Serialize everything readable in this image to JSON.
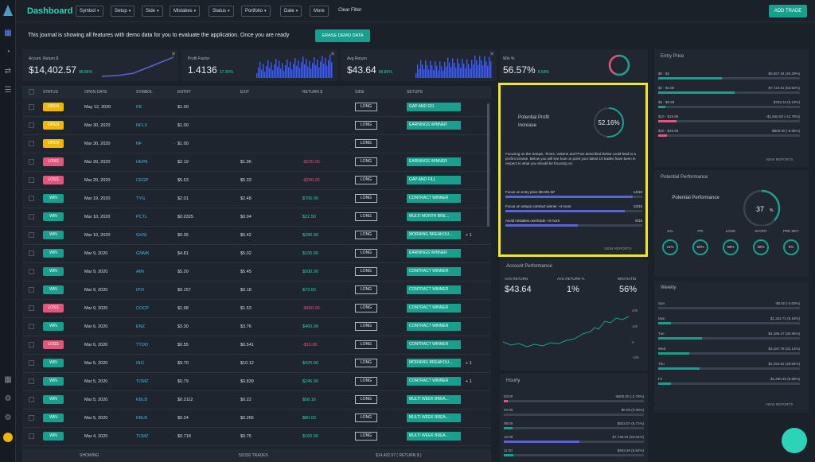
{
  "header": {
    "title": "Dashboard",
    "clear_filter": "Clear Filter",
    "add_trade": "ADD TRADE",
    "filters": [
      "Symbol",
      "Setup",
      "Side",
      "Mistakes",
      "Status",
      "Portfolio",
      "Date",
      "More"
    ]
  },
  "notice": {
    "text": "This journal is showing all features with demo data for you to evaluate the application. Once you are ready",
    "erase": "ERASE DEMO DATA"
  },
  "kpis": [
    {
      "label": "Accum. Return $",
      "value": "$14,402.57",
      "change": "98.86%"
    },
    {
      "label": "Profit Factor",
      "value": "1.4136",
      "change": "17.26%"
    },
    {
      "label": "Avg Return",
      "value": "$43.64",
      "change": "99.86%"
    },
    {
      "label": "Win %",
      "value": "56.57%",
      "change": "8.59%"
    }
  ],
  "table": {
    "headers": [
      "STATUS",
      "OPEN DATE",
      "SYMBOL",
      "ENTRY",
      "EXIT",
      "RETURN $",
      "SIDE",
      "SETUPS"
    ],
    "rows": [
      {
        "status": "OPEN",
        "date": "May 12, 2020",
        "symbol": "FB",
        "entry": "$1.00",
        "exit": "",
        "ret": "",
        "side": "LONG",
        "setup": "GAP AND GO",
        "plus": ""
      },
      {
        "status": "OPEN",
        "date": "Mar 30, 2020",
        "symbol": "NFLX",
        "entry": "$1.00",
        "exit": "",
        "ret": "",
        "side": "LONG",
        "setup": "EARNINGS WINNER",
        "plus": ""
      },
      {
        "status": "OPEN",
        "date": "Mar 30, 2020",
        "symbol": "NF",
        "entry": "$1.00",
        "exit": "",
        "ret": "",
        "side": "LONG",
        "setup": "",
        "plus": ""
      },
      {
        "status": "LOSS",
        "date": "Mar 20, 2020",
        "symbol": "HEPA",
        "entry": "$2.19",
        "exit": "$1.96",
        "ret": "-$230.00",
        "side": "LONG",
        "setup": "EARNINGS WINNER",
        "plus": ""
      },
      {
        "status": "LOSS",
        "date": "Mar 20, 2020",
        "symbol": "CEGP",
        "entry": "$5.53",
        "exit": "$5.33",
        "ret": "-$200.00",
        "side": "LONG",
        "setup": "GAP AND FILL",
        "plus": ""
      },
      {
        "status": "WIN",
        "date": "Mar 19, 2020",
        "symbol": "TYG",
        "entry": "$2.01",
        "exit": "$2.48",
        "ret": "$705.00",
        "side": "LONG",
        "setup": "CONTRACT WINNER",
        "plus": ""
      },
      {
        "status": "WIN",
        "date": "Mar 10, 2020",
        "symbol": "PCTL",
        "entry": "$0.0325",
        "exit": "$0.04",
        "ret": "$22.50",
        "side": "LONG",
        "setup": "MULTI MONTH BRE...",
        "plus": ""
      },
      {
        "status": "WIN",
        "date": "Mar 10, 2020",
        "symbol": "GHSI",
        "entry": "$0.36",
        "exit": "$0.42",
        "ret": "$280.00",
        "side": "LONG",
        "setup": "MORNING BREAKOU...",
        "plus": "+ 1"
      },
      {
        "status": "WIN",
        "date": "Mar 9, 2020",
        "symbol": "GNMK",
        "entry": "$4.81",
        "exit": "$5.02",
        "ret": "$105.00",
        "side": "LONG",
        "setup": "EARNINGS WINNER",
        "plus": ""
      },
      {
        "status": "WIN",
        "date": "Mar 9, 2020",
        "symbol": "AIM",
        "entry": "$5.20",
        "exit": "$5.45",
        "ret": "$500.00",
        "side": "LONG",
        "setup": "CONTRACT WINNER",
        "plus": ""
      },
      {
        "status": "WIN",
        "date": "Mar 9, 2020",
        "symbol": "IPIX",
        "entry": "$0.157",
        "exit": "$0.18",
        "ret": "$73.60",
        "side": "LONG",
        "setup": "CONTRACT WINNER",
        "plus": ""
      },
      {
        "status": "LOSS",
        "date": "Mar 9, 2020",
        "symbol": "COCP",
        "entry": "$1.98",
        "exit": "$1.53",
        "ret": "-$450.00",
        "side": "LONG",
        "setup": "CONTRACT WINNER",
        "plus": ""
      },
      {
        "status": "WIN",
        "date": "Mar 6, 2020",
        "symbol": "ENZ",
        "entry": "$3.30",
        "exit": "$3.76",
        "ret": "$460.00",
        "side": "LONG",
        "setup": "CONTRACT WINNER",
        "plus": ""
      },
      {
        "status": "LOSS",
        "date": "Mar 6, 2020",
        "symbol": "TTOO",
        "entry": "$0.55",
        "exit": "$0.541",
        "ret": "-$10.80",
        "side": "LONG",
        "setup": "CONTRACT WINNER",
        "plus": ""
      },
      {
        "status": "WIN",
        "date": "Mar 5, 2020",
        "symbol": "INO",
        "entry": "$9.70",
        "exit": "$10.12",
        "ret": "$420.00",
        "side": "LONG",
        "setup": "MORNING BREAKOU...",
        "plus": "+ 1"
      },
      {
        "status": "WIN",
        "date": "Mar 5, 2020",
        "symbol": "TOMZ",
        "entry": "$0.79",
        "exit": "$0.839",
        "ret": "$245.00",
        "side": "LONG",
        "setup": "CONTRACT WINNER",
        "plus": "+ 1"
      },
      {
        "status": "WIN",
        "date": "Mar 5, 2020",
        "symbol": "KBLB",
        "entry": "$0.2112",
        "exit": "$0.22",
        "ret": "$58.16",
        "side": "LONG",
        "setup": "MULTI WEEK BREA...",
        "plus": ""
      },
      {
        "status": "WIN",
        "date": "Mar 5, 2020",
        "symbol": "KBLB",
        "entry": "$0.24",
        "exit": "$0.265",
        "ret": "$80.00",
        "side": "LONG",
        "setup": "MULTI WEEK BREA...",
        "plus": ""
      },
      {
        "status": "WIN",
        "date": "Mar 4, 2020",
        "symbol": "TOMZ",
        "entry": "$0.718",
        "exit": "$0.75",
        "ret": "$160.00",
        "side": "LONG",
        "setup": "MULTI WEEK BREA...",
        "plus": ""
      }
    ],
    "footer": {
      "showing": "SHOWING",
      "trades": "50/330 TRADES",
      "total": "$14,402.57 ( RETURN $ )"
    }
  },
  "profit": {
    "title": "Potential Profit Increase",
    "pct": "52.16%",
    "pct_fraction": 0.52,
    "desc": "Focusing on the Setups, Times, Volume and Price described below could lead to a profit increase. Below you will see how on point your latest 15 trades have been in respect to what you should be focusing on",
    "items": [
      {
        "label": "Focus on entry price $0.001-$7",
        "score": "14/15",
        "frac": 0.93
      },
      {
        "label": "Focus on setups contract winner +4 more",
        "score": "13/15",
        "frac": 0.87
      },
      {
        "label": "Avoid mistakes overtrade +3 more",
        "score": "8/15",
        "frac": 0.53
      }
    ],
    "view": "VIEW REPORTS"
  },
  "account": {
    "title": "Account Performance",
    "stats": [
      {
        "l": "AVG RETURN",
        "v": "$43.64"
      },
      {
        "l": "AVG RETURN %",
        "v": "1%"
      },
      {
        "l": "WIN RATIO",
        "v": "56%"
      }
    ],
    "y_ticks": [
      "20k",
      "10k",
      "0",
      "-10k"
    ]
  },
  "hourly": {
    "title": "Hourly",
    "rows": [
      {
        "l": "03:00",
        "r": "-$400.00 (-2.78%)",
        "frac": 0.03,
        "c": "#e3557a"
      },
      {
        "l": "04:00",
        "r": "$0.00 (0.00%)",
        "frac": 0,
        "c": "#17a08e"
      },
      {
        "l": "09:00",
        "r": "$823.07 (5.71%)",
        "frac": 0.06,
        "c": "#17a08e"
      },
      {
        "l": "10:00",
        "r": "$7,736.04 (53.64%)",
        "frac": 0.54,
        "c": "#5b63d6"
      },
      {
        "l": "11:00",
        "r": "$953.49 (6.62%)",
        "frac": 0.07,
        "c": "#17a08e"
      }
    ]
  },
  "entry": {
    "title": "Entry Price",
    "rows": [
      {
        "l": "$0 - $2",
        "r": "$6,557.34 (45.29%)",
        "frac": 0.45,
        "c": "#17a08e"
      },
      {
        "l": "$2 - $4.99",
        "r": "$7,722.61 (53.62%)",
        "frac": 0.54,
        "c": "#17a08e"
      },
      {
        "l": "$5 - $9.99",
        "r": "$753.10 (5.23%)",
        "frac": 0.05,
        "c": "#17a08e"
      },
      {
        "l": "$10 - $19.99",
        "r": "-$1,840.00 (-12.79%)",
        "frac": 0.13,
        "c": "#e3557a"
      },
      {
        "l": "$20 - $49.99",
        "r": "-$800.00 (-5.56%)",
        "frac": 0.06,
        "c": "#e3557a"
      }
    ],
    "view": "VIEW REPORTS"
  },
  "potential": {
    "title": "Potential Performance",
    "label": "Potential Performance",
    "pct": "37",
    "unit": "%",
    "frac": 0.37,
    "circles": [
      {
        "l": "JUL",
        "v": "41%"
      },
      {
        "l": "FRI",
        "v": "50%"
      },
      {
        "l": "LONG",
        "v": "58%"
      },
      {
        "l": "SHORT",
        "v": "38%"
      },
      {
        "l": "PRE MKT",
        "v": "0%"
      }
    ]
  },
  "weekly": {
    "title": "Weekly",
    "rows": [
      {
        "l": "Sun",
        "r": "-$0.60 (-0.00%)",
        "frac": 0,
        "c": "#e3557a"
      },
      {
        "l": "Mon",
        "r": "$1,322.71 (9.18%)",
        "frac": 0.09,
        "c": "#17a08e"
      },
      {
        "l": "Tue",
        "r": "$4,486.47 (30.96%)",
        "frac": 0.31,
        "c": "#17a08e"
      },
      {
        "l": "Wed",
        "r": "$3,187.78 (22.13%)",
        "frac": 0.22,
        "c": "#17a08e"
      },
      {
        "l": "Thu",
        "r": "$4,153.62 (28.84%)",
        "frac": 0.29,
        "c": "#17a08e"
      },
      {
        "l": "Fri",
        "r": "$1,280.49 (8.89%)",
        "frac": 0.09,
        "c": "#17a08e"
      }
    ],
    "view": "VIEW REPORTS"
  },
  "colors": {
    "accent": "#17a08e",
    "open": "#f2b705",
    "loss": "#e3557a",
    "win": "#17a08e",
    "highlight": "#f4e71d"
  }
}
